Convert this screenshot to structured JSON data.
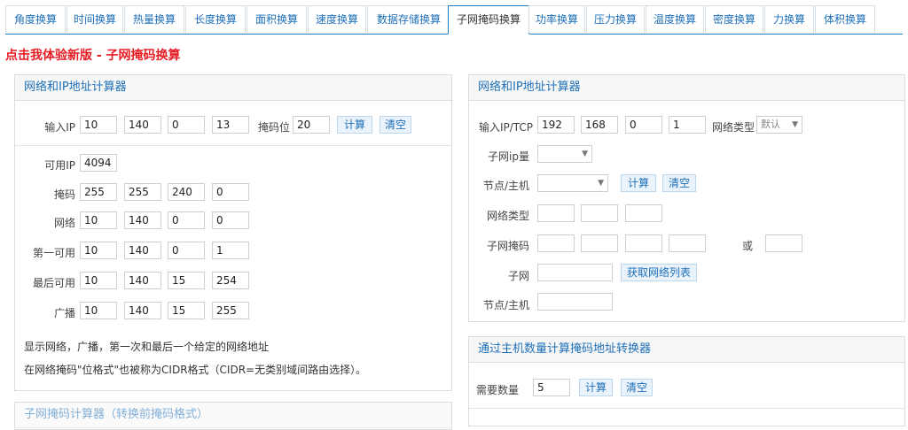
{
  "tabs": [
    "角度换算",
    "时间换算",
    "热量换算",
    "长度换算",
    "面积换算",
    "速度换算",
    "数据存储换算",
    "子网掩码换算",
    "功率换算",
    "压力换算",
    "温度换算",
    "密度换算",
    "力换算",
    "体积换算"
  ],
  "active_tab": "子网掩码换算",
  "promo": "点击我体验新版 - 子网掩码换算",
  "left": {
    "title": "网络和IP地址计算器",
    "ip_label": "输入IP",
    "ip": [
      "10",
      "140",
      "0",
      "13"
    ],
    "mask_bits_label": "掩码位",
    "mask_bits": "20",
    "calc": "计算",
    "clear": "清空",
    "usable_label": "可用IP",
    "usable": "4094",
    "rows": [
      {
        "label": "掩码",
        "values": [
          "255",
          "255",
          "240",
          "0"
        ]
      },
      {
        "label": "网络",
        "values": [
          "10",
          "140",
          "0",
          "0"
        ]
      },
      {
        "label": "第一可用",
        "values": [
          "10",
          "140",
          "0",
          "1"
        ]
      },
      {
        "label": "最后可用",
        "values": [
          "10",
          "140",
          "15",
          "254"
        ]
      },
      {
        "label": "广播",
        "values": [
          "10",
          "140",
          "15",
          "255"
        ]
      }
    ],
    "note1": "显示网络，广播，第一次和最后一个给定的网络地址",
    "note2": "在网络掩码\"位格式\"也被称为CIDR格式（CIDR=无类别域间路由选择）。",
    "next_title_partial": "子网掩码计算器（转换前掩码格式）"
  },
  "right": {
    "title": "网络和IP地址计算器",
    "ip_label": "输入IP/TCP",
    "ip": [
      "192",
      "168",
      "0",
      "1"
    ],
    "nettype_label": "网络类型",
    "nettype_value": "默认",
    "subnet_count_label": "子网ip量",
    "node_host_label": "节点/主机",
    "calc": "计算",
    "clear": "清空",
    "net_type_label": "网络类型",
    "subnet_mask_label": "子网掩码",
    "or_label": "或",
    "subnet_label": "子网",
    "get_list": "获取网络列表",
    "node_host_label2": "节点/主机"
  },
  "right2": {
    "title": "通过主机数量计算掩码地址转换器",
    "need_label": "需要数量",
    "need_value": "5",
    "calc": "计算",
    "clear": "清空"
  }
}
